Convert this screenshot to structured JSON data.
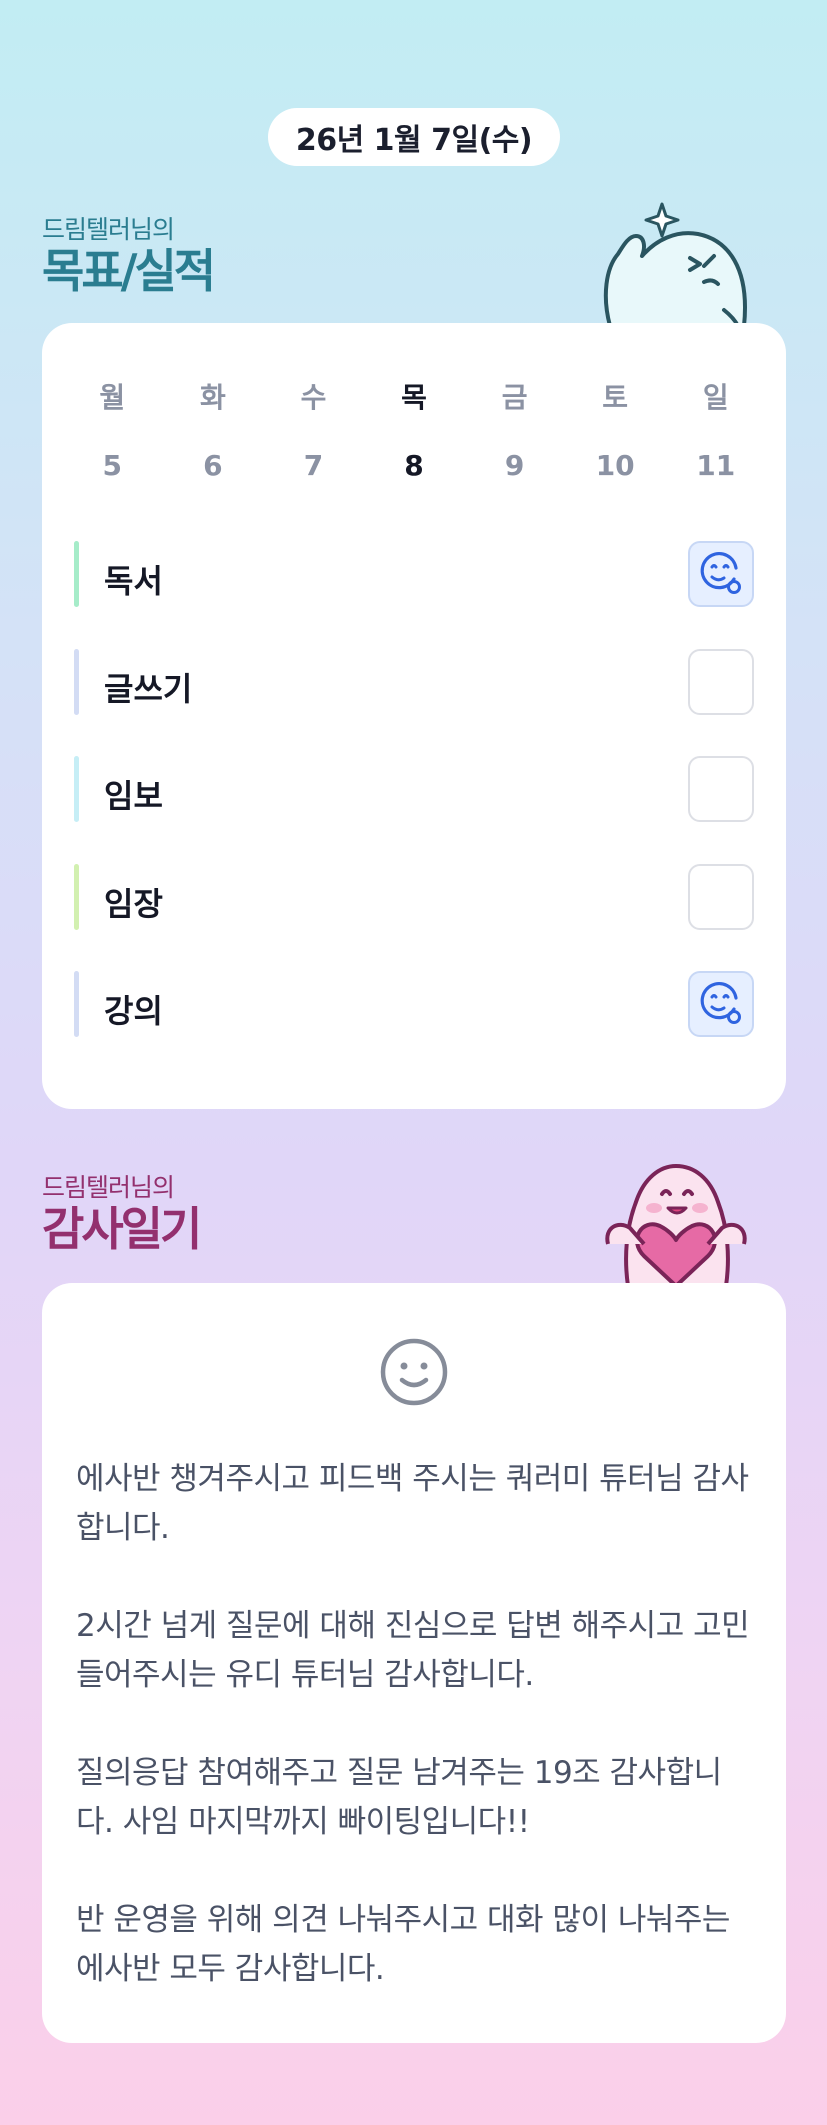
{
  "header": {
    "date": "26년 1월 7일(수)"
  },
  "goal_section": {
    "subtitle": "드림텔러님의",
    "title": "목표/실적"
  },
  "week": {
    "days": [
      "월",
      "화",
      "수",
      "목",
      "금",
      "토",
      "일"
    ],
    "dates": [
      "5",
      "6",
      "7",
      "8",
      "9",
      "10",
      "11"
    ],
    "today_index": 3
  },
  "goals": [
    {
      "label": "독서",
      "done": true,
      "color": "#a6ecc9"
    },
    {
      "label": "글쓰기",
      "done": false,
      "color": "#d3dcf4"
    },
    {
      "label": "임보",
      "done": false,
      "color": "#c6eef6"
    },
    {
      "label": "임장",
      "done": false,
      "color": "#d2f0b0"
    },
    {
      "label": "강의",
      "done": true,
      "color": "#d3dcf4"
    }
  ],
  "gratitude_section": {
    "subtitle": "드림텔러님의",
    "title": "감사일기"
  },
  "gratitude": {
    "mood_icon": "smile-icon",
    "entries": [
      "에사반 챙겨주시고 피드백 주시는 쿼러미 튜터님 감사합니다.",
      "2시간 넘게 질문에 대해 진심으로 답변 해주시고 고민 들어주시는 유디 튜터님 감사합니다.",
      "질의응답 참여해주고 질문 남겨주는 19조 감사합니다. 사임 마지막까지 빠이팅입니다!!",
      "반 운영을 위해 의견 나눠주시고 대화 많이 나눠주는 에사반 모두 감사합니다."
    ]
  },
  "colors": {
    "goal_accent": "#2a7d90",
    "gratitude_accent": "#93306e",
    "check_done_bg": "#e6efff",
    "check_icon": "#2f64e0"
  }
}
